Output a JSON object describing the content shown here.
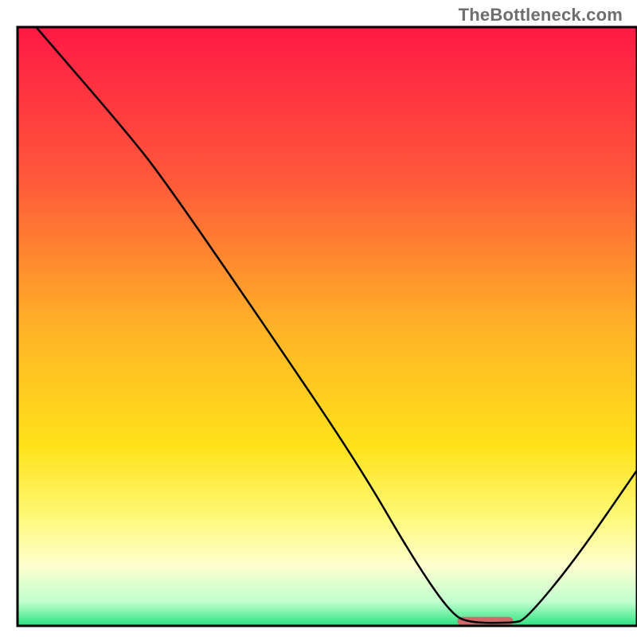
{
  "watermark": "TheBottleneck.com",
  "chart_data": {
    "type": "line",
    "title": "",
    "xlabel": "",
    "ylabel": "",
    "xlim": [
      0,
      100
    ],
    "ylim": [
      0,
      100
    ],
    "background_gradient_stops": [
      {
        "offset": 0.0,
        "color": "#ff1945"
      },
      {
        "offset": 0.26,
        "color": "#ff5a3a"
      },
      {
        "offset": 0.5,
        "color": "#ffb227"
      },
      {
        "offset": 0.7,
        "color": "#ffe21a"
      },
      {
        "offset": 0.82,
        "color": "#fff97a"
      },
      {
        "offset": 0.9,
        "color": "#fdffd0"
      },
      {
        "offset": 0.96,
        "color": "#c1ffcf"
      },
      {
        "offset": 1.0,
        "color": "#29e37e"
      }
    ],
    "series": [
      {
        "name": "bottleneck-curve",
        "points": [
          {
            "x": 3,
            "y": 100
          },
          {
            "x": 18,
            "y": 82
          },
          {
            "x": 24,
            "y": 74
          },
          {
            "x": 40,
            "y": 50
          },
          {
            "x": 55,
            "y": 27
          },
          {
            "x": 64,
            "y": 11
          },
          {
            "x": 70,
            "y": 2
          },
          {
            "x": 73,
            "y": 0.5
          },
          {
            "x": 80,
            "y": 0.5
          },
          {
            "x": 82,
            "y": 1
          },
          {
            "x": 90,
            "y": 11
          },
          {
            "x": 100,
            "y": 26
          }
        ],
        "stroke": "#000000",
        "stroke_width": 2.5
      }
    ],
    "markers": [
      {
        "name": "optimal-segment",
        "shape": "rounded-rect",
        "x_start": 71,
        "x_end": 80,
        "y": 0.8,
        "height_pct": 1.4,
        "fill": "#d06a6a"
      }
    ],
    "plot_frame": {
      "stroke": "#000000",
      "stroke_width": 3
    }
  }
}
